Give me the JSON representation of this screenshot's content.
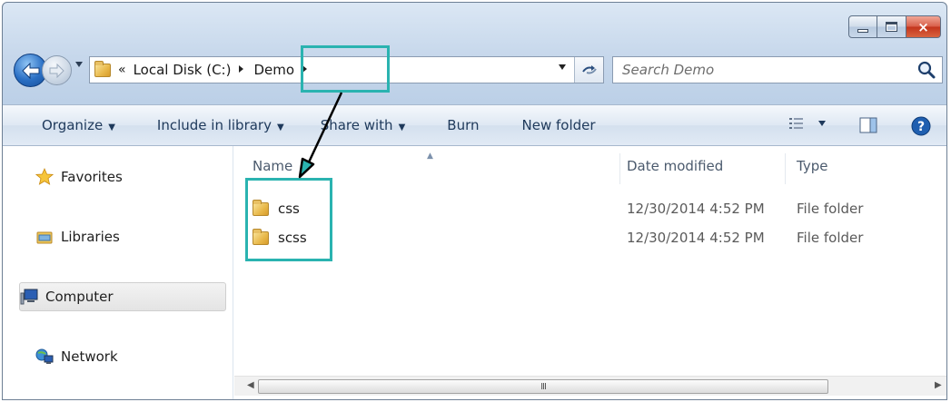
{
  "window": {
    "close_glyph": "×"
  },
  "nav": {
    "breadcrumb_chevron": "«",
    "crumbs": [
      "Local Disk (C:)",
      "Demo"
    ],
    "search_placeholder": "Search Demo"
  },
  "toolbar": {
    "organize": "Organize",
    "include_in_library": "Include in library",
    "share_with": "Share with",
    "burn": "Burn",
    "new_folder": "New folder"
  },
  "sidebar": {
    "items": [
      {
        "label": "Favorites",
        "icon": "star-icon"
      },
      {
        "label": "Libraries",
        "icon": "libraries-icon"
      },
      {
        "label": "Computer",
        "icon": "computer-icon"
      },
      {
        "label": "Network",
        "icon": "network-icon"
      }
    ]
  },
  "file_list": {
    "columns": [
      "Name",
      "Date modified",
      "Type"
    ],
    "rows": [
      {
        "name": "css",
        "date_modified": "12/30/2014 4:52 PM",
        "type": "File folder"
      },
      {
        "name": "scss",
        "date_modified": "12/30/2014 4:52 PM",
        "type": "File folder"
      }
    ],
    "scroll_thumb_grip": "III"
  },
  "colors": {
    "annotation": "#2ab3b0",
    "arrow": "#000000"
  }
}
